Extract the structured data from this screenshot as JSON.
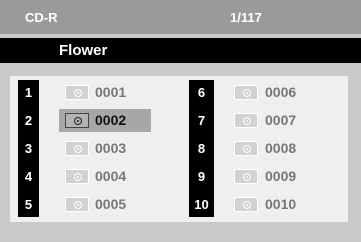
{
  "header": {
    "source": "CD-R",
    "page_indicator": "1/117"
  },
  "folder": {
    "title": "Flower"
  },
  "tracks": [
    {
      "number": "1",
      "name": "0001",
      "selected": false
    },
    {
      "number": "2",
      "name": "0002",
      "selected": true
    },
    {
      "number": "3",
      "name": "0003",
      "selected": false
    },
    {
      "number": "4",
      "name": "0004",
      "selected": false
    },
    {
      "number": "5",
      "name": "0005",
      "selected": false
    },
    {
      "number": "6",
      "name": "0006",
      "selected": false
    },
    {
      "number": "7",
      "name": "0007",
      "selected": false
    },
    {
      "number": "8",
      "name": "0008",
      "selected": false
    },
    {
      "number": "9",
      "name": "0009",
      "selected": false
    },
    {
      "number": "10",
      "name": "0010",
      "selected": false
    }
  ],
  "icon": "disc-icon"
}
